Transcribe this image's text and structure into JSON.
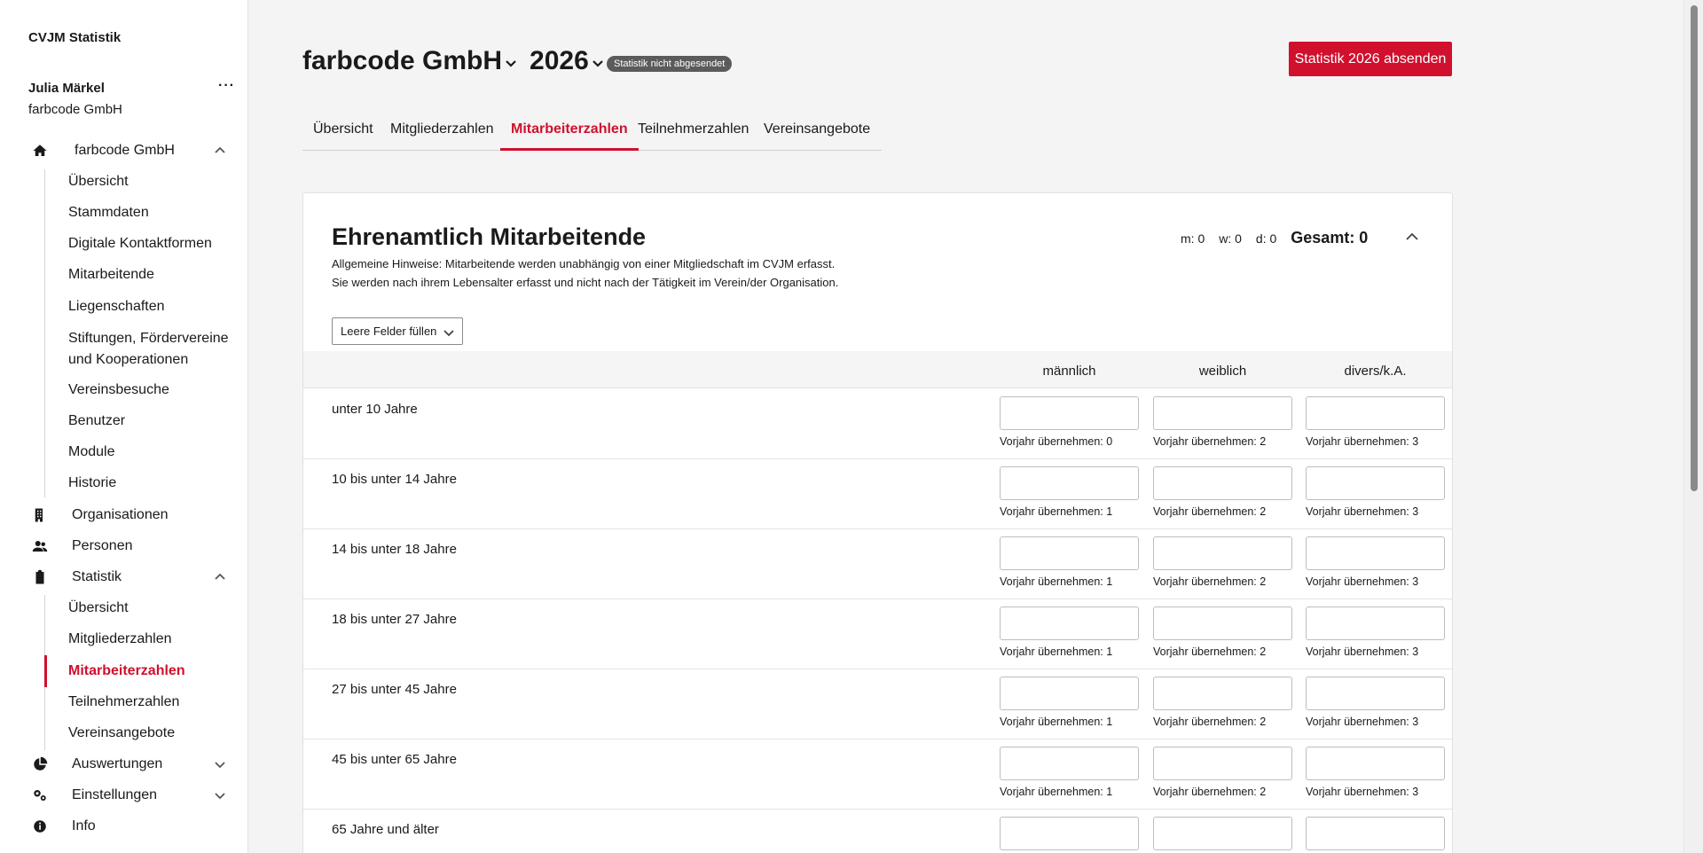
{
  "app": {
    "title": "CVJM Statistik"
  },
  "user": {
    "name": "Julia Märkel",
    "org": "farbcode GmbH",
    "more": "···"
  },
  "nav": {
    "org_label": "farbcode GmbH",
    "org_items": [
      "Übersicht",
      "Stammdaten",
      "Digitale Kontaktformen",
      "Mitarbeitende",
      "Liegenschaften",
      "Stiftungen, Fördervereine und Kooperationen",
      "Vereinsbesuche",
      "Benutzer",
      "Module",
      "Historie"
    ],
    "organisationen": "Organisationen",
    "personen": "Personen",
    "statistik": "Statistik",
    "statistik_items": [
      "Übersicht",
      "Mitgliederzahlen",
      "Mitarbeiterzahlen",
      "Teilnehmerzahlen",
      "Vereinsangebote"
    ],
    "statistik_active": "Mitarbeiterzahlen",
    "auswertungen": "Auswertungen",
    "einstellungen": "Einstellungen",
    "info": "Info"
  },
  "header": {
    "org": "farbcode GmbH",
    "year": "2026",
    "status": "Statistik nicht abgesendet",
    "submit_label": "Statistik 2026 absenden"
  },
  "tabs": [
    "Übersicht",
    "Mitgliederzahlen",
    "Mitarbeiterzahlen",
    "Teilnehmerzahlen",
    "Vereinsangebote"
  ],
  "active_tab": "Mitarbeiterzahlen",
  "section": {
    "title": "Ehrenamtlich Mitarbeitende",
    "hint_line1": "Allgemeine Hinweise: Mitarbeitende werden unabhängig von einer Mitgliedschaft im CVJM erfasst.",
    "hint_line2": "Sie werden nach ihrem Lebensalter erfasst und nicht nach der Tätigkeit im Verein/der Organisation.",
    "count_m": "m: 0",
    "count_w": "w: 0",
    "count_d": "d: 0",
    "total": "Gesamt: 0",
    "fill_label": "Leere Felder füllen",
    "columns": [
      "männlich",
      "weiblich",
      "divers/k.A."
    ],
    "rows": [
      {
        "label": "unter 10 Jahre",
        "prev": [
          "Vorjahr übernehmen: 0",
          "Vorjahr übernehmen: 2",
          "Vorjahr übernehmen: 3"
        ]
      },
      {
        "label": "10 bis unter 14 Jahre",
        "prev": [
          "Vorjahr übernehmen: 1",
          "Vorjahr übernehmen: 2",
          "Vorjahr übernehmen: 3"
        ]
      },
      {
        "label": "14 bis unter 18 Jahre",
        "prev": [
          "Vorjahr übernehmen: 1",
          "Vorjahr übernehmen: 2",
          "Vorjahr übernehmen: 3"
        ]
      },
      {
        "label": "18 bis unter 27 Jahre",
        "prev": [
          "Vorjahr übernehmen: 1",
          "Vorjahr übernehmen: 2",
          "Vorjahr übernehmen: 3"
        ]
      },
      {
        "label": "27 bis unter 45 Jahre",
        "prev": [
          "Vorjahr übernehmen: 1",
          "Vorjahr übernehmen: 2",
          "Vorjahr übernehmen: 3"
        ]
      },
      {
        "label": "45 bis unter 65 Jahre",
        "prev": [
          "Vorjahr übernehmen: 1",
          "Vorjahr übernehmen: 2",
          "Vorjahr übernehmen: 3"
        ]
      },
      {
        "label": "65 Jahre und älter",
        "prev": [
          "",
          "",
          ""
        ]
      }
    ]
  },
  "colors": {
    "accent": "#d0102d",
    "badge": "#5b5b5b"
  }
}
